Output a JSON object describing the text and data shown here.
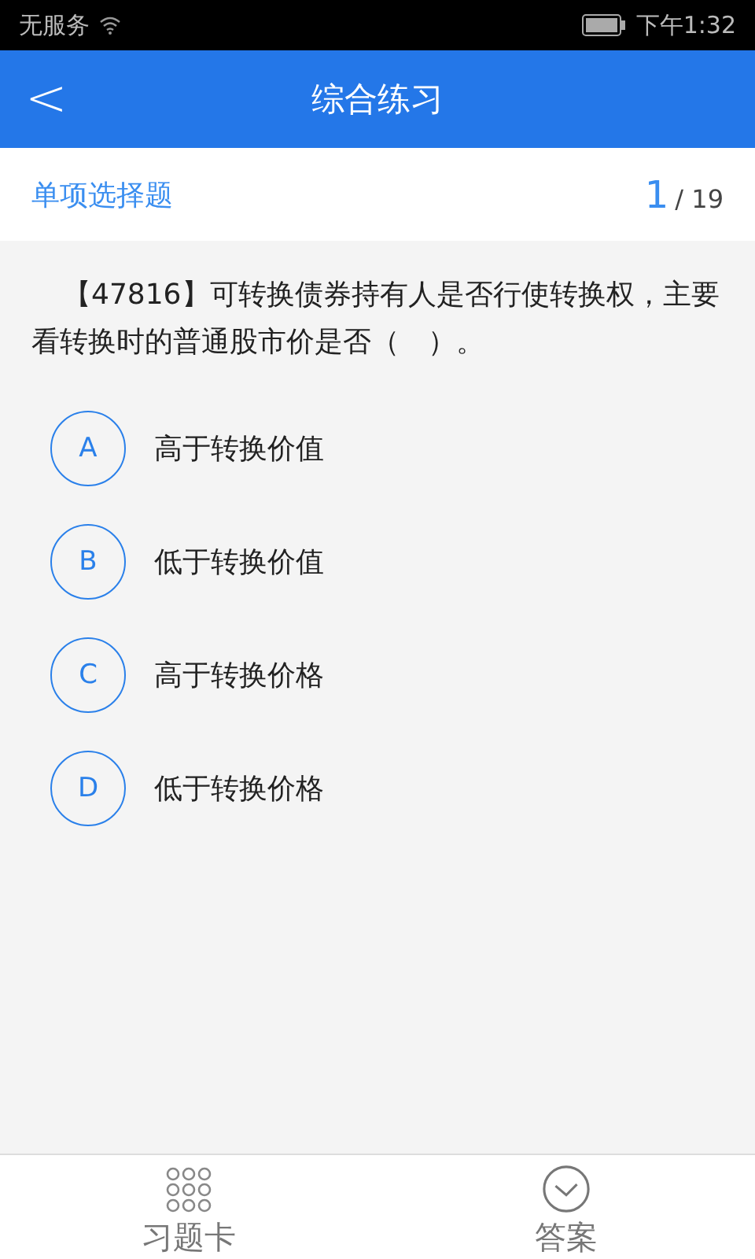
{
  "status_bar": {
    "carrier": "无服务",
    "time": "下午1:32"
  },
  "header": {
    "back": "<",
    "title": "综合练习"
  },
  "subheader": {
    "type": "单项选择题",
    "current": "1",
    "total": "/ 19"
  },
  "question": "【47816】可转换债券持有人是否行使转换权，主要看转换时的普通股市价是否（　）。",
  "options": [
    {
      "letter": "A",
      "text": "高于转换价值",
      "selected": false
    },
    {
      "letter": "B",
      "text": "低于转换价值",
      "selected": false
    },
    {
      "letter": "C",
      "text": "高于转换价格",
      "selected": false
    },
    {
      "letter": "D",
      "text": "低于转换价格",
      "selected": false
    }
  ],
  "bottom_bar": [
    {
      "kind": "card",
      "label": "习题卡"
    },
    {
      "kind": "answer",
      "label": "答案"
    }
  ]
}
